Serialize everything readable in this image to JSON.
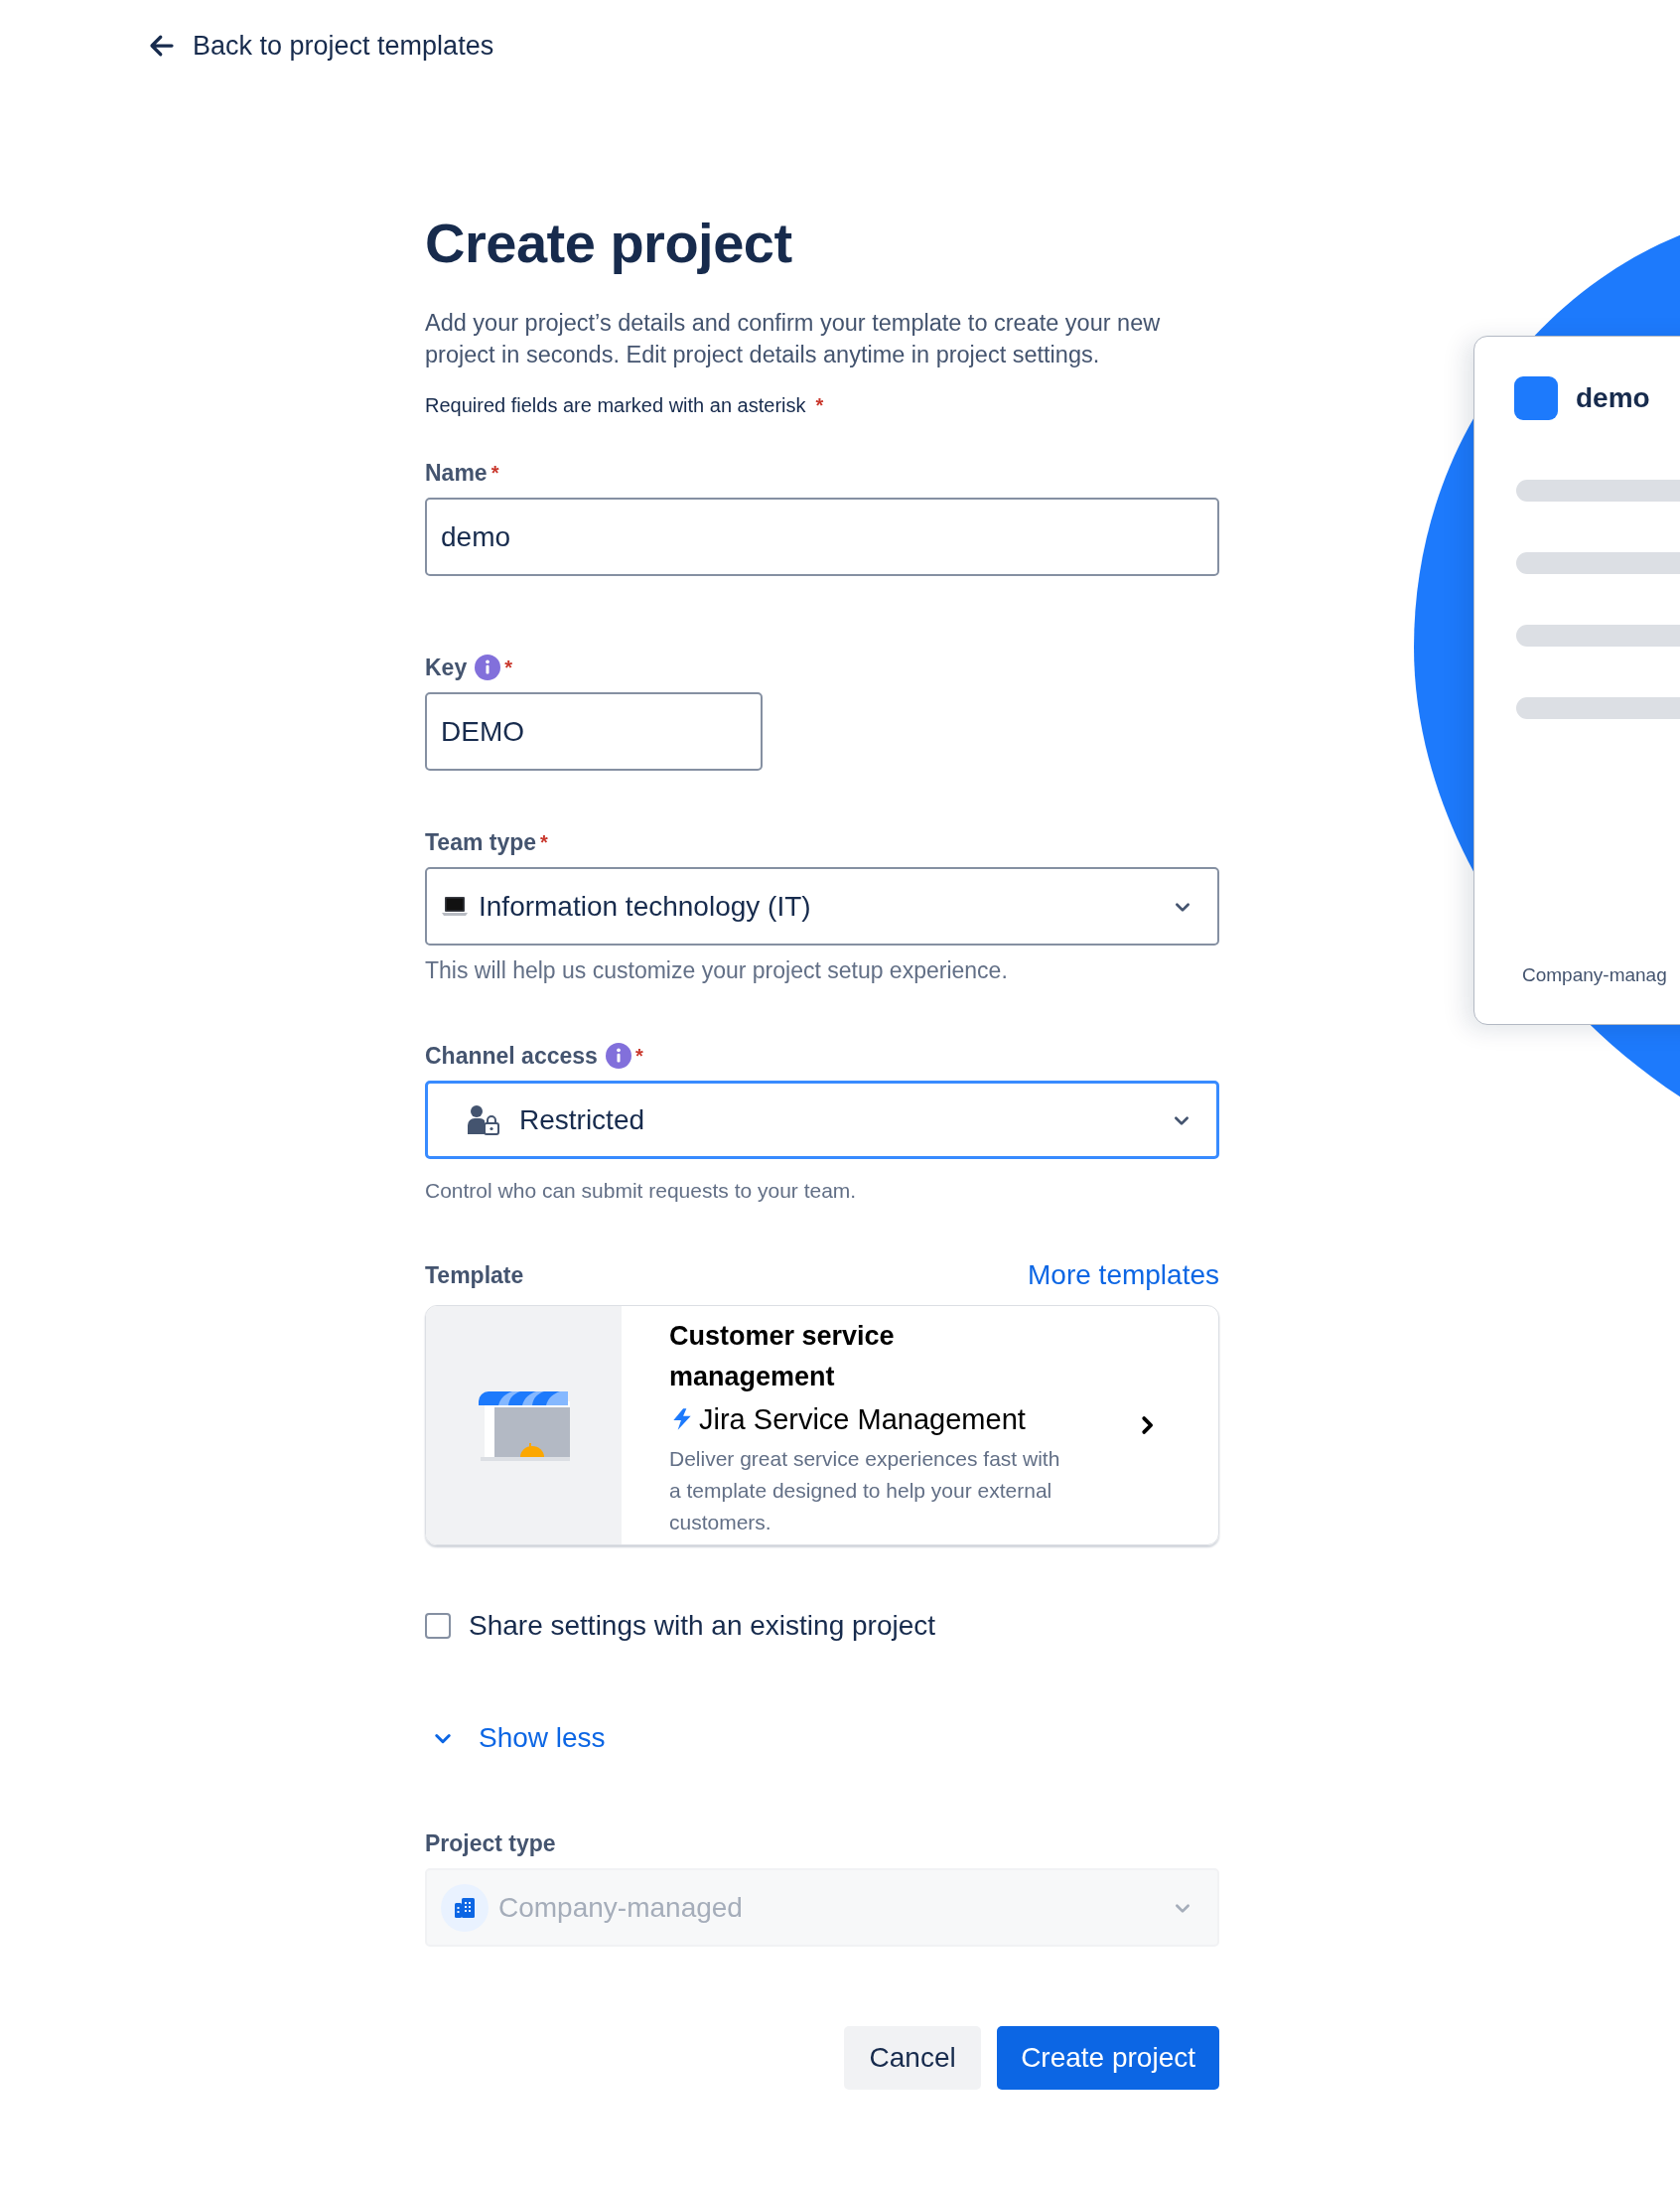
{
  "back_link": {
    "label": "Back to project templates"
  },
  "title": "Create project",
  "description": "Add your project’s details and confirm your template to create your new project in seconds. Edit project details anytime in project settings.",
  "required_note": {
    "text": "Required fields are marked with an asterisk",
    "mark": "*"
  },
  "fields": [
    {
      "kind": "text",
      "label": "Name",
      "required_mark": "*",
      "info": false,
      "value": "demo",
      "focused": false
    },
    {
      "kind": "short_text",
      "label": "Key",
      "required_mark": "*",
      "info": true,
      "value": "DEMO",
      "focused": false
    },
    {
      "kind": "select",
      "label": "Team type",
      "required_mark": "*",
      "info": false,
      "value": "Information technology (IT)",
      "focused": false,
      "help": "This will help us customize your project setup experience."
    },
    {
      "kind": "select",
      "label": "Channel access",
      "required_mark": "*",
      "info": true,
      "value": "Restricted",
      "focused": true,
      "help": "Control who can submit requests to your team."
    }
  ],
  "template": {
    "label": "Template",
    "more_link": "More templates",
    "card": {
      "title": "Customer service management",
      "product": "Jira Service Management",
      "description": "Deliver great service experiences fast with a template designed to help your external customers."
    }
  },
  "share_settings": {
    "label": "Share settings with an existing project",
    "checked": false
  },
  "show_toggle": {
    "label": "Show less",
    "expanded": true
  },
  "project_type": {
    "label": "Project type",
    "value": "Company-managed",
    "disabled": true
  },
  "buttons": [
    {
      "kind": "secondary",
      "label": "Cancel"
    },
    {
      "kind": "primary",
      "label": "Create project"
    }
  ],
  "preview": {
    "name": "demo",
    "type": "Company-manag"
  }
}
